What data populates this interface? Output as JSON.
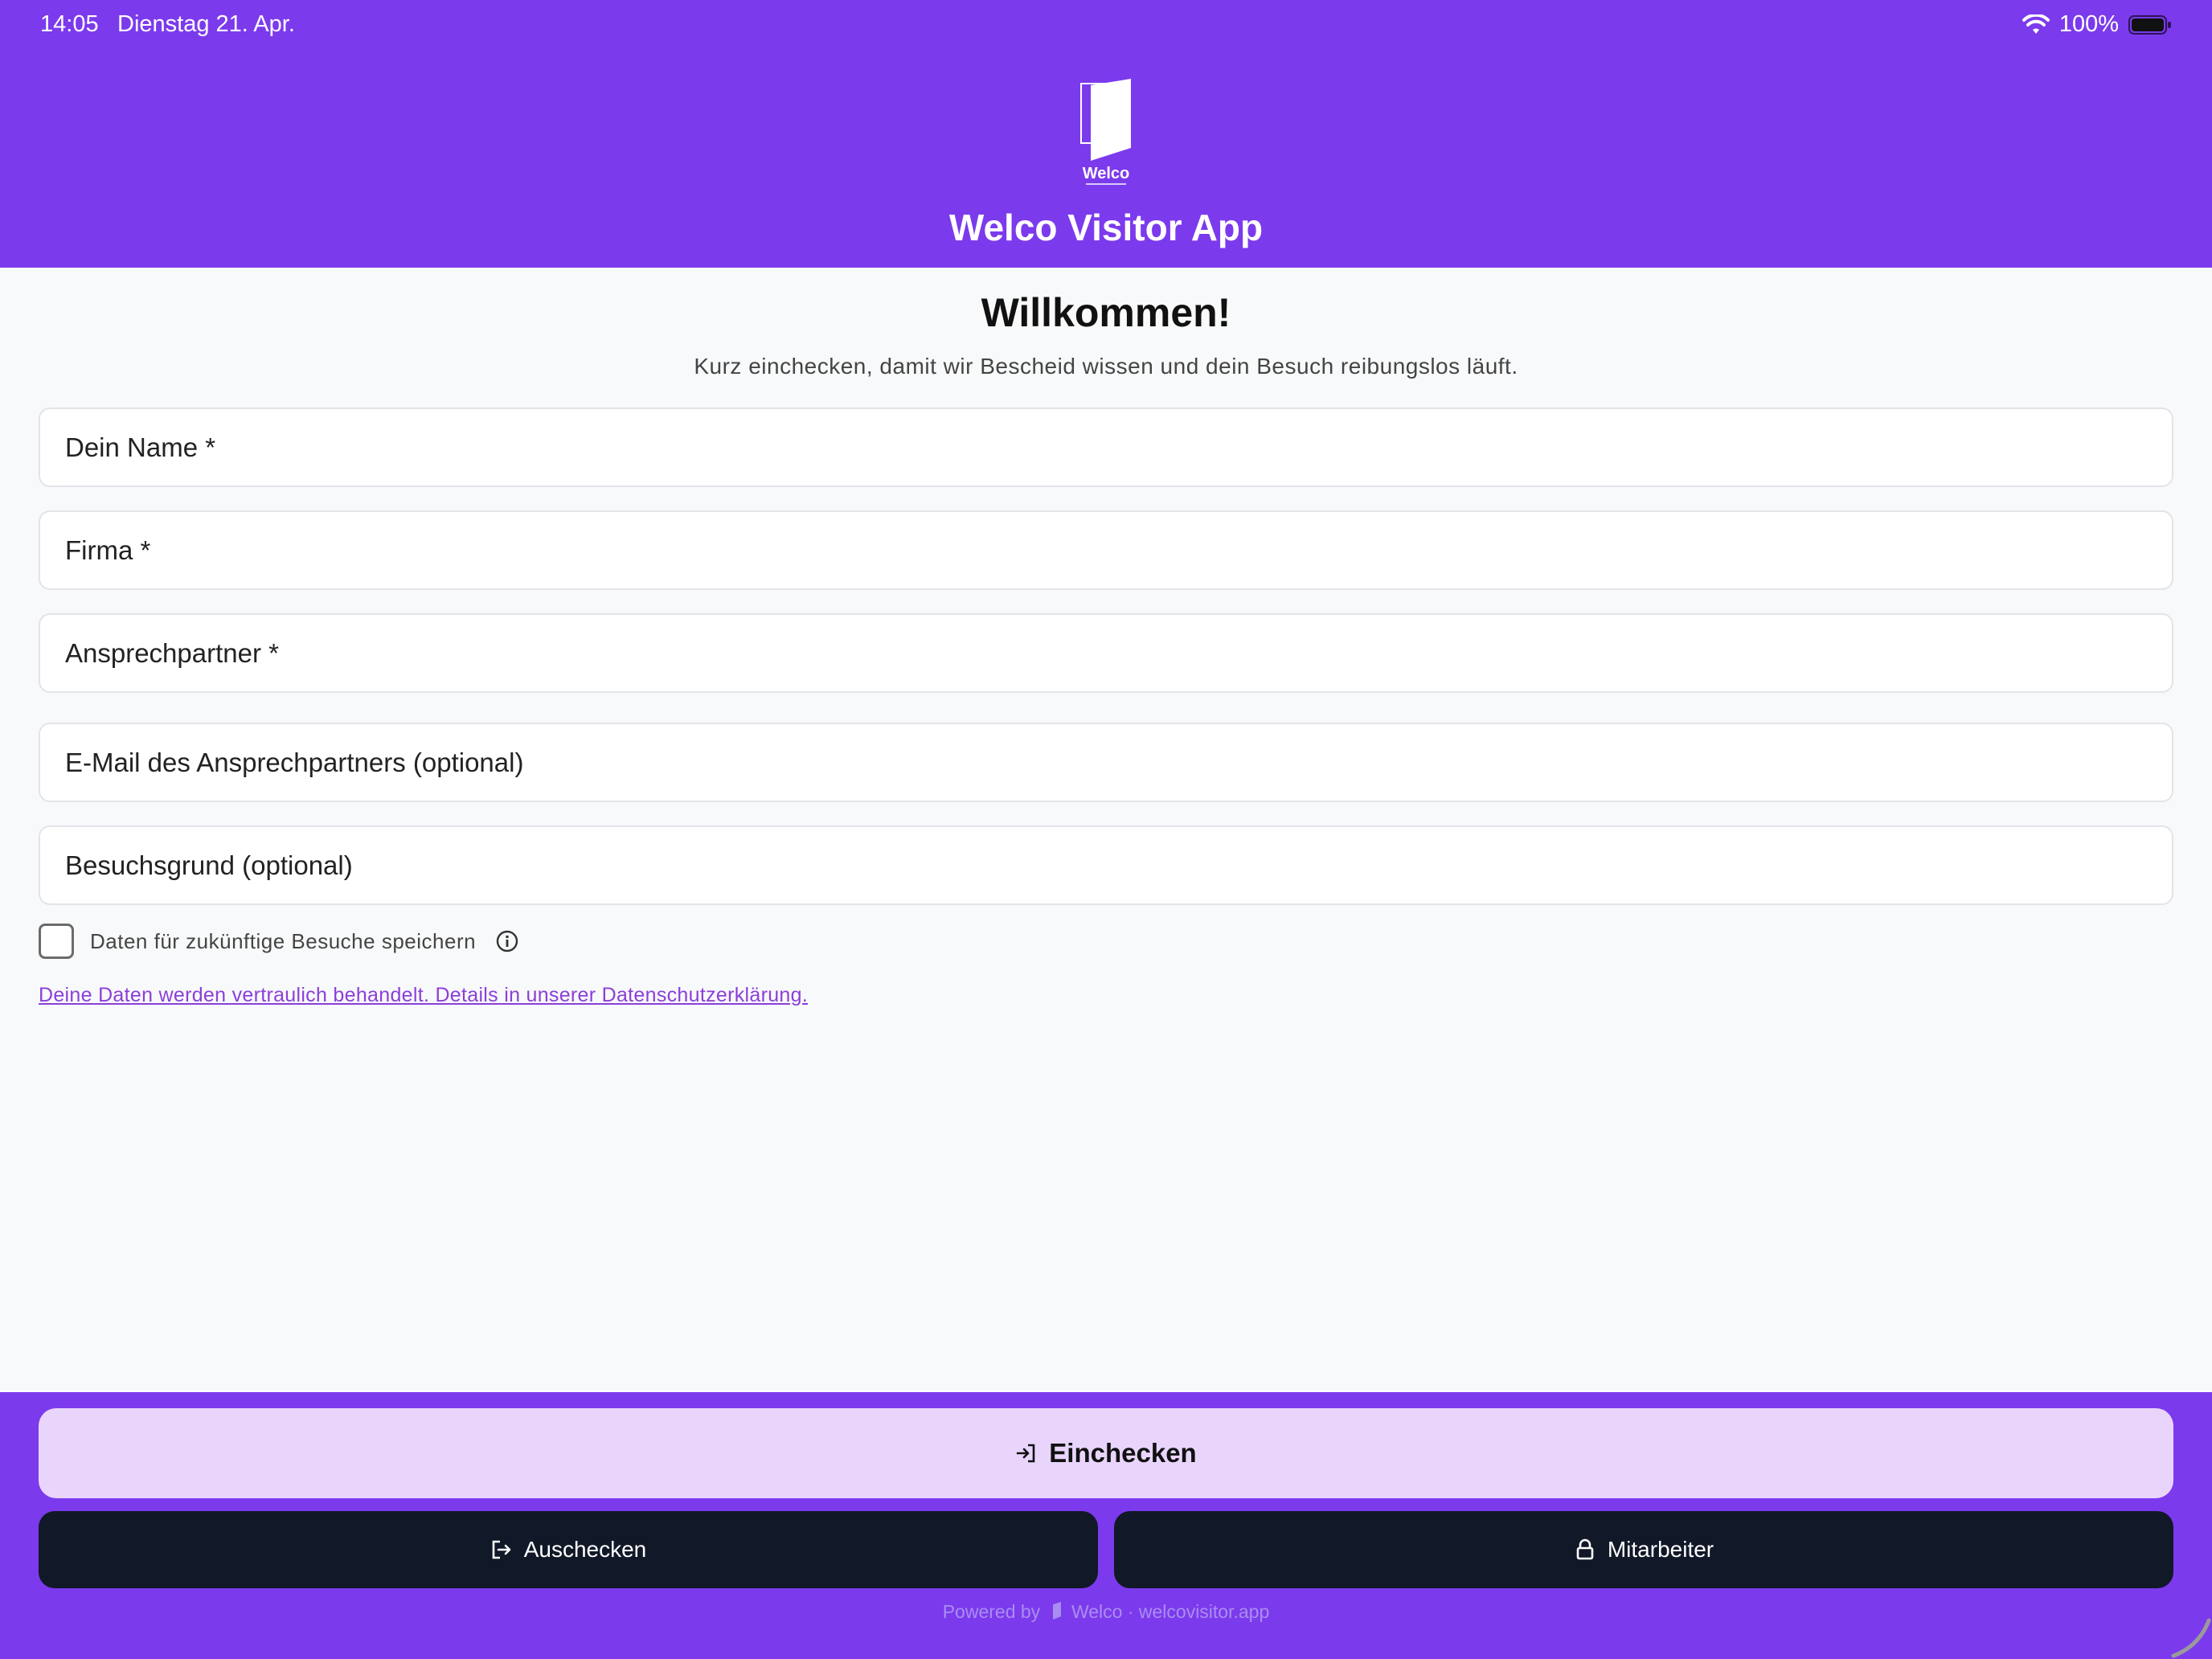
{
  "status_bar": {
    "time": "14:05",
    "date": "Dienstag 21. Apr.",
    "battery": "100%"
  },
  "header": {
    "logo_text": "Welco",
    "title": "Welco Visitor App",
    "brand_color": "#7c3aed"
  },
  "main": {
    "welcome": "Willkommen!",
    "subtitle": "Kurz einchecken, damit wir Bescheid wissen und dein Besuch reibungslos läuft.",
    "fields": [
      {
        "placeholder": "Dein Name *",
        "value": ""
      },
      {
        "placeholder": "Firma *",
        "value": ""
      },
      {
        "placeholder": "Ansprechpartner *",
        "value": ""
      },
      {
        "placeholder": "E-Mail des Ansprechpartners (optional)",
        "value": ""
      },
      {
        "placeholder": "Besuchsgrund (optional)",
        "value": ""
      }
    ],
    "save_checkbox": {
      "label": "Daten für zukünftige Besuche speichern",
      "checked": false
    },
    "privacy_link": "Deine Daten werden vertraulich behandelt. Details in unserer Datenschutzerklärung."
  },
  "footer": {
    "checkin_label": "Einchecken",
    "checkout_label": "Auschecken",
    "staff_label": "Mitarbeiter",
    "powered_prefix": "Powered by",
    "powered_brand": "Welco · welcovisitor.app"
  },
  "icons": {
    "wifi": "wifi-icon",
    "battery": "battery-icon",
    "info": "info-icon",
    "checkin": "sign-in-icon",
    "checkout": "sign-out-icon",
    "staff": "lock-icon"
  }
}
